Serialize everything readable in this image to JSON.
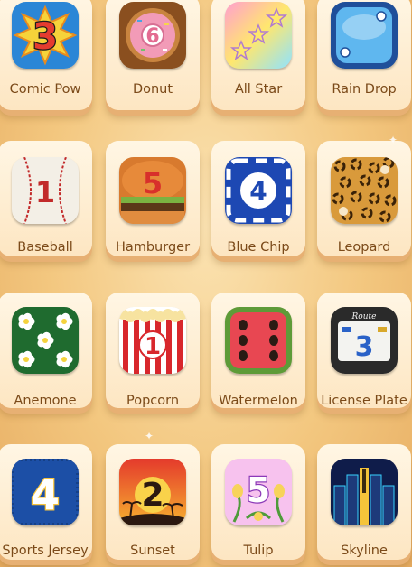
{
  "themes": [
    {
      "label": "Comic Pow",
      "icon": "comic-pow-icon",
      "number": "3",
      "colors": [
        "#2b86d6",
        "#f6d33a",
        "#e53c2f"
      ]
    },
    {
      "label": "Donut",
      "icon": "donut-icon",
      "number": "6",
      "colors": [
        "#c8843f",
        "#f29bb7",
        "#ffffff"
      ]
    },
    {
      "label": "All Star",
      "icon": "all-star-icon",
      "number": "",
      "colors": [
        "#ff9fcf",
        "#ffe76e",
        "#8fe3ff"
      ]
    },
    {
      "label": "Rain Drop",
      "icon": "rain-drop-icon",
      "number": "",
      "colors": [
        "#1f4f9a",
        "#5fb7ef",
        "#ffffff"
      ]
    },
    {
      "label": "Baseball",
      "icon": "baseball-icon",
      "number": "1",
      "colors": [
        "#f3efe6",
        "#c22a2a"
      ]
    },
    {
      "label": "Hamburger",
      "icon": "hamburger-icon",
      "number": "5",
      "colors": [
        "#e78a3a",
        "#5b3718",
        "#7bb241"
      ]
    },
    {
      "label": "Blue Chip",
      "icon": "blue-chip-icon",
      "number": "4",
      "colors": [
        "#1d48b3",
        "#ffffff"
      ]
    },
    {
      "label": "Leopard",
      "icon": "leopard-icon",
      "number": "",
      "colors": [
        "#d99a3b",
        "#3a2208"
      ]
    },
    {
      "label": "Anemone",
      "icon": "anemone-icon",
      "number": "",
      "colors": [
        "#1f6b2f",
        "#ffffff"
      ]
    },
    {
      "label": "Popcorn",
      "icon": "popcorn-icon",
      "number": "1",
      "colors": [
        "#d8272c",
        "#ffffff",
        "#f7e3a0"
      ]
    },
    {
      "label": "Watermelon",
      "icon": "watermelon-icon",
      "number": "",
      "colors": [
        "#e84752",
        "#5e9b38",
        "#2a1b14"
      ]
    },
    {
      "label": "License Plate",
      "icon": "license-plate-icon",
      "number": "3",
      "colors": [
        "#2a2a2a",
        "#f3f3f0",
        "#2a62c8"
      ]
    },
    {
      "label": "Sports Jersey",
      "icon": "sports-jersey-icon",
      "number": "4",
      "colors": [
        "#1c4fa6",
        "#f7c43d"
      ]
    },
    {
      "label": "Sunset",
      "icon": "sunset-icon",
      "number": "2",
      "colors": [
        "#e43a2c",
        "#f7b22f",
        "#2b1810"
      ]
    },
    {
      "label": "Tulip",
      "icon": "tulip-icon",
      "number": "5",
      "colors": [
        "#f7c2ee",
        "#8c3ab8",
        "#f7d35a"
      ]
    },
    {
      "label": "Skyline",
      "icon": "skyline-icon",
      "number": "",
      "colors": [
        "#0f1c4a",
        "#38d2ff",
        "#f5c43a"
      ]
    }
  ]
}
